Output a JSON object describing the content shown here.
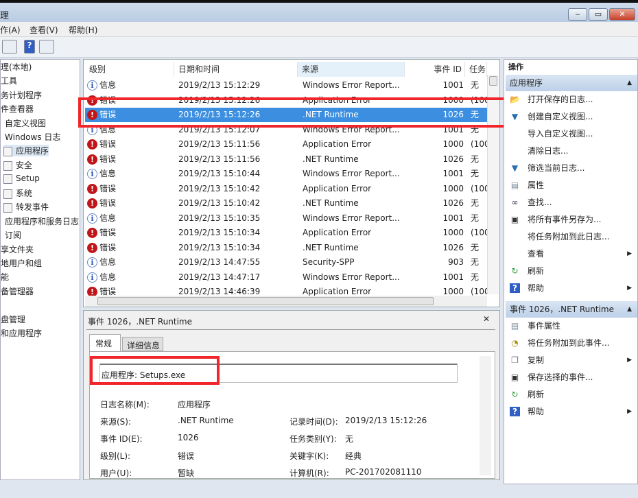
{
  "window": {
    "title": "理",
    "minimize": "‒",
    "maximize": "▭",
    "close": "✕"
  },
  "menu": [
    "作(A)",
    "查看(V)",
    "帮助(H)"
  ],
  "tree": [
    "理(本地)",
    "工具",
    "务计划程序",
    "件查看器",
    "自定义视图",
    "Windows 日志",
    "应用程序",
    "安全",
    "Setup",
    "系统",
    "转发事件",
    "应用程序和服务日志",
    "订阅",
    "享文件夹",
    "地用户和组",
    "能",
    "备管理器",
    "盘管理",
    "和应用程序"
  ],
  "list": {
    "headers": [
      "级别",
      "日期和时间",
      "来源",
      "事件 ID",
      "任务"
    ],
    "rows": [
      {
        "type": "info",
        "level": "信息",
        "date": "2019/2/13 15:12:29",
        "source": "Windows Error Report...",
        "id": "1001",
        "task": "无"
      },
      {
        "type": "err",
        "level": "错误",
        "date": "2019/2/13 15:12:26",
        "source": "Application Error",
        "id": "1000",
        "task": "(100"
      },
      {
        "type": "err",
        "level": "错误",
        "date": "2019/2/13 15:12:26",
        "source": ".NET Runtime",
        "id": "1026",
        "task": "无",
        "selected": true
      },
      {
        "type": "info",
        "level": "信息",
        "date": "2019/2/13 15:12:07",
        "source": "Windows Error Report...",
        "id": "1001",
        "task": "无"
      },
      {
        "type": "err",
        "level": "错误",
        "date": "2019/2/13 15:11:56",
        "source": "Application Error",
        "id": "1000",
        "task": "(100"
      },
      {
        "type": "err",
        "level": "错误",
        "date": "2019/2/13 15:11:56",
        "source": ".NET Runtime",
        "id": "1026",
        "task": "无"
      },
      {
        "type": "info",
        "level": "信息",
        "date": "2019/2/13 15:10:44",
        "source": "Windows Error Report...",
        "id": "1001",
        "task": "无"
      },
      {
        "type": "err",
        "level": "错误",
        "date": "2019/2/13 15:10:42",
        "source": "Application Error",
        "id": "1000",
        "task": "(100"
      },
      {
        "type": "err",
        "level": "错误",
        "date": "2019/2/13 15:10:42",
        "source": ".NET Runtime",
        "id": "1026",
        "task": "无"
      },
      {
        "type": "info",
        "level": "信息",
        "date": "2019/2/13 15:10:35",
        "source": "Windows Error Report...",
        "id": "1001",
        "task": "无"
      },
      {
        "type": "err",
        "level": "错误",
        "date": "2019/2/13 15:10:34",
        "source": "Application Error",
        "id": "1000",
        "task": "(100"
      },
      {
        "type": "err",
        "level": "错误",
        "date": "2019/2/13 15:10:34",
        "source": ".NET Runtime",
        "id": "1026",
        "task": "无"
      },
      {
        "type": "info",
        "level": "信息",
        "date": "2019/2/13 14:47:55",
        "source": "Security-SPP",
        "id": "903",
        "task": "无"
      },
      {
        "type": "info",
        "level": "信息",
        "date": "2019/2/13 14:47:17",
        "source": "Windows Error Report...",
        "id": "1001",
        "task": "无"
      },
      {
        "type": "err",
        "level": "错误",
        "date": "2019/2/13 14:46:39",
        "source": "Application Error",
        "id": "1000",
        "task": "(100"
      }
    ]
  },
  "detail": {
    "title": "事件 1026，.NET Runtime",
    "close": "✕",
    "tabs": [
      "常规",
      "详细信息"
    ],
    "message": "应用程序: Setups.exe",
    "fields": {
      "log_label": "日志名称(M):",
      "log": "应用程序",
      "source_label": "来源(S):",
      "source": ".NET Runtime",
      "logged_label": "记录时间(D):",
      "logged": "2019/2/13 15:12:26",
      "id_label": "事件 ID(E):",
      "id": "1026",
      "task_label": "任务类别(Y):",
      "task": "无",
      "level_label": "级别(L):",
      "level": "错误",
      "kw_label": "关键字(K):",
      "kw": "经典",
      "user_label": "用户(U):",
      "user": "暂缺",
      "computer_label": "计算机(R):",
      "computer": "PC-201702081110"
    }
  },
  "actions": {
    "header": "操作",
    "sec1": "应用程序",
    "items1": [
      {
        "icon": "open-folder",
        "label": "打开保存的日志..."
      },
      {
        "icon": "filter",
        "label": "创建自定义视图..."
      },
      {
        "icon": "",
        "label": "导入自定义视图..."
      },
      {
        "icon": "",
        "label": "清除日志..."
      },
      {
        "icon": "filter",
        "label": "筛选当前日志..."
      },
      {
        "icon": "properties",
        "label": "属性"
      },
      {
        "icon": "binoculars",
        "label": "查找..."
      },
      {
        "icon": "save",
        "label": "将所有事件另存为..."
      },
      {
        "icon": "",
        "label": "将任务附加到此日志..."
      },
      {
        "icon": "",
        "label": "查看",
        "arrow": true
      },
      {
        "icon": "refresh",
        "label": "刷新"
      },
      {
        "icon": "help",
        "label": "帮助",
        "arrow": true
      }
    ],
    "sec2": "事件 1026，.NET Runtime",
    "items2": [
      {
        "icon": "properties",
        "label": "事件属性"
      },
      {
        "icon": "task",
        "label": "将任务附加到此事件..."
      },
      {
        "icon": "copy",
        "label": "复制",
        "arrow": true
      },
      {
        "icon": "save",
        "label": "保存选择的事件..."
      },
      {
        "icon": "refresh",
        "label": "刷新"
      },
      {
        "icon": "help",
        "label": "帮助",
        "arrow": true
      }
    ]
  }
}
